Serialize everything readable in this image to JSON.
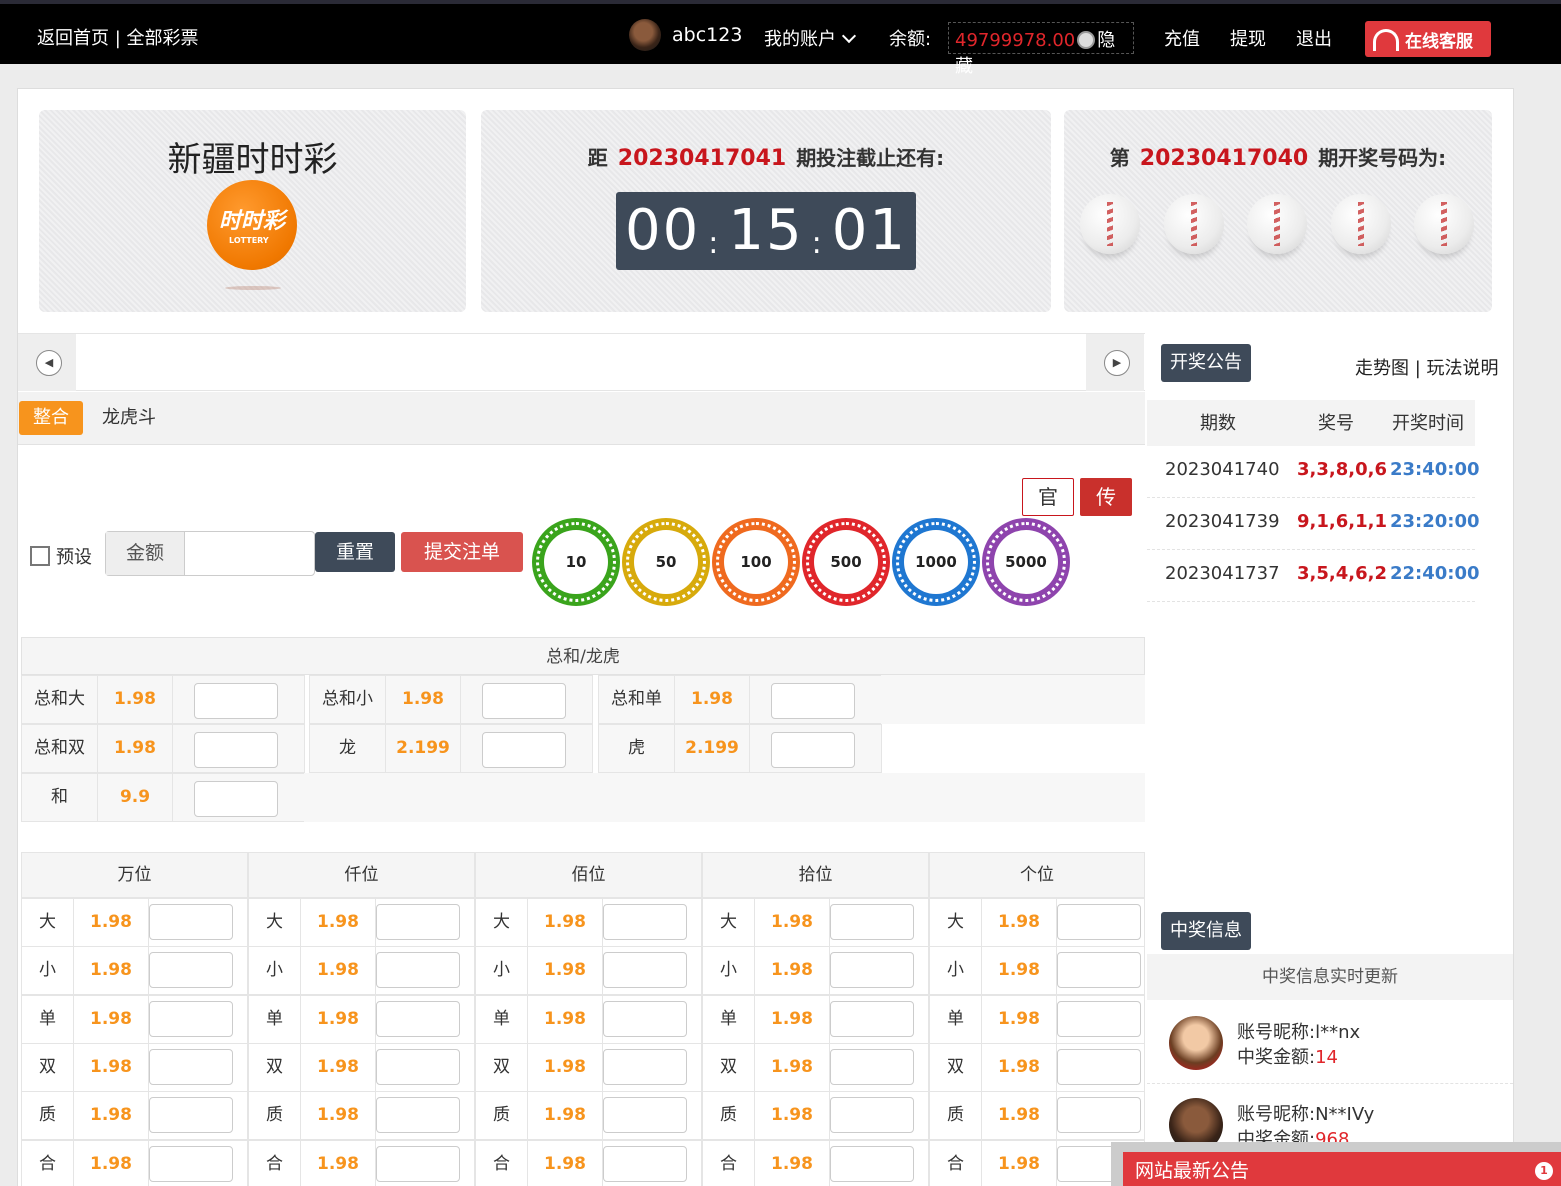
{
  "topbar": {
    "home_link": "返回首页 | 全部彩票",
    "username": "abc123",
    "account_menu": "我的账户",
    "balance_label": "余额:",
    "balance_value": "49799978.00",
    "hide_label": "隐藏",
    "recharge": "充值",
    "withdraw": "提现",
    "logout": "退出",
    "service": "在线客服"
  },
  "lottery": {
    "name": "新疆时时彩",
    "logo_text": "时时彩",
    "logo_sub": "LOTTERY"
  },
  "countdown": {
    "prefix": "距",
    "issue": "20230417041",
    "suffix": "期投注截止还有:",
    "hh": "00",
    "mm": "15",
    "ss": "01",
    "sep": ":"
  },
  "last_draw": {
    "prefix": "第",
    "issue": "20230417040",
    "suffix": "期开奖号码为:"
  },
  "tabs": [
    "整合",
    "龙虎斗"
  ],
  "controls": {
    "preset_label": "预设",
    "amount_label": "金额",
    "reset": "重置",
    "submit": "提交注单",
    "guan": "官",
    "chuan": "传",
    "chips": [
      "10",
      "50",
      "100",
      "500",
      "1000",
      "5000"
    ]
  },
  "chip_colors": [
    "#3aa41c",
    "#d7aa0c",
    "#ef6a1f",
    "#e0262b",
    "#1f77d1",
    "#8e44ad"
  ],
  "total_section": {
    "title": "总和/龙虎",
    "items": [
      {
        "label": "总和大",
        "odd": "1.98"
      },
      {
        "label": "总和小",
        "odd": "1.98"
      },
      {
        "label": "总和单",
        "odd": "1.98"
      },
      {
        "label": "总和双",
        "odd": "1.98"
      },
      {
        "label": "龙",
        "odd": "2.199"
      },
      {
        "label": "虎",
        "odd": "2.199"
      },
      {
        "label": "和",
        "odd": "9.9"
      }
    ]
  },
  "positions": {
    "columns": [
      "万位",
      "仟位",
      "佰位",
      "拾位",
      "个位"
    ],
    "rows": [
      {
        "label": "大",
        "odd": "1.98"
      },
      {
        "label": "小",
        "odd": "1.98"
      },
      {
        "label": "单",
        "odd": "1.98"
      },
      {
        "label": "双",
        "odd": "1.98"
      },
      {
        "label": "质",
        "odd": "1.98"
      },
      {
        "label": "合",
        "odd": "1.98"
      }
    ]
  },
  "right_panel": {
    "draw_button": "开奖公告",
    "links": "走势图 | 玩法说明",
    "headers": [
      "期数",
      "奖号",
      "开奖时间"
    ],
    "draws": [
      {
        "issue": "2023041740",
        "nums": "3,3,8,0,6",
        "time": "23:40:00"
      },
      {
        "issue": "2023041739",
        "nums": "9,1,6,1,1",
        "time": "23:20:00"
      },
      {
        "issue": "2023041737",
        "nums": "3,5,4,6,2",
        "time": "22:40:00"
      }
    ],
    "win_button": "中奖信息",
    "win_subtitle": "中奖信息实时更新",
    "nick_label": "账号昵称:",
    "amount_label": "中奖金额:",
    "winners": [
      {
        "nick": "l**nx",
        "amount": "14"
      },
      {
        "nick": "N**IVy",
        "amount": "968"
      }
    ]
  },
  "notice": {
    "title": "网站最新公告",
    "badge": "1"
  }
}
